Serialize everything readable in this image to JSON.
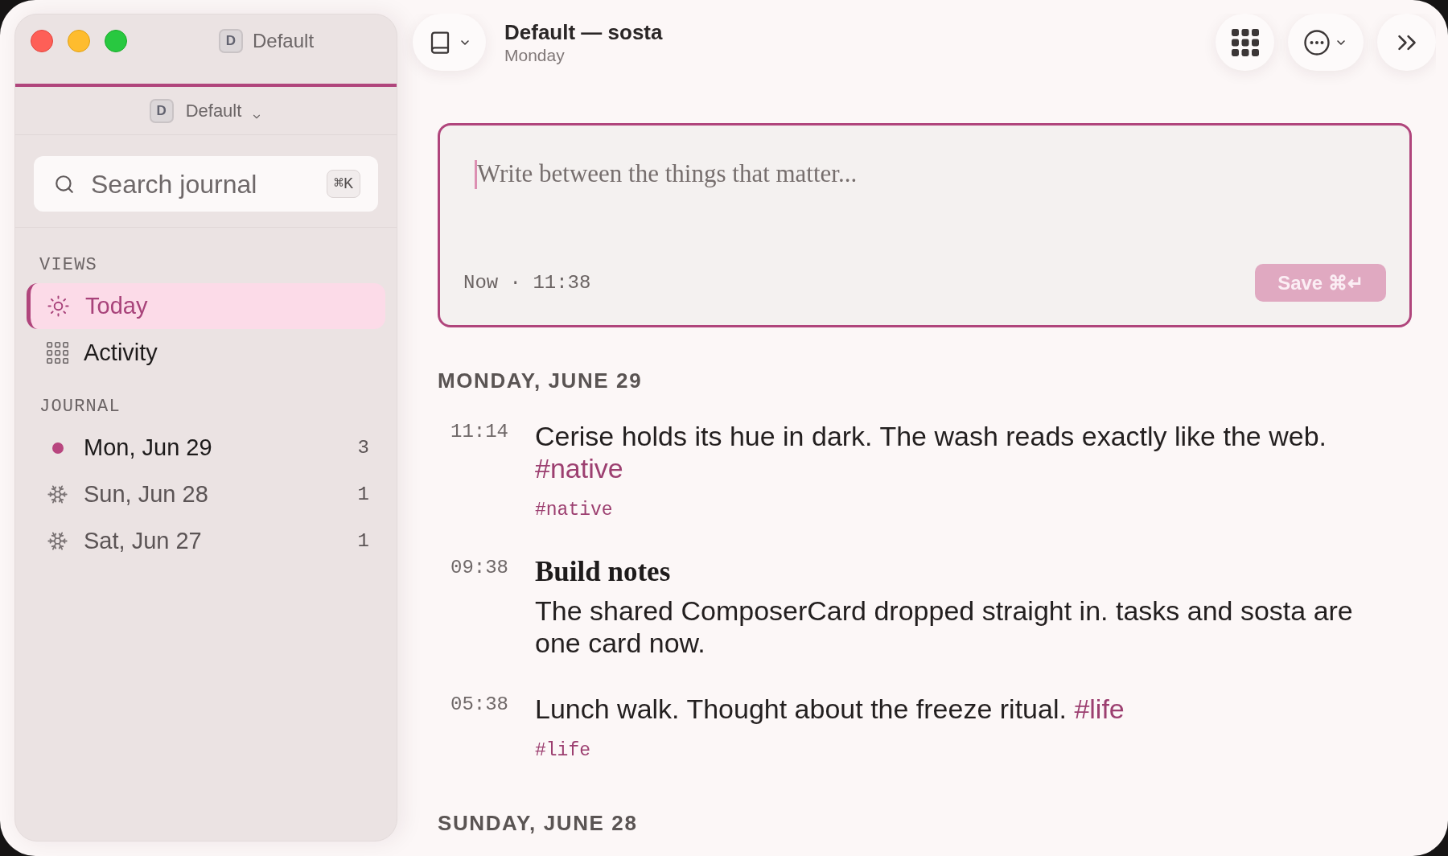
{
  "sidebar": {
    "title_bar": {
      "badge": "D",
      "title": "Default"
    },
    "workspace_switcher": {
      "badge": "D",
      "label": "Default"
    },
    "search": {
      "placeholder": "Search journal",
      "shortcut": "⌘K"
    },
    "sections": [
      {
        "heading": "VIEWS",
        "items": [
          {
            "kind": "today",
            "label": "Today",
            "selected": true
          },
          {
            "kind": "activity",
            "label": "Activity",
            "selected": false
          }
        ]
      },
      {
        "heading": "JOURNAL",
        "items": [
          {
            "kind": "current",
            "label": "Mon, Jun 29",
            "count": "3",
            "selected": false
          },
          {
            "kind": "frozen",
            "label": "Sun, Jun 28",
            "count": "1",
            "selected": false
          },
          {
            "kind": "frozen",
            "label": "Sat, Jun 27",
            "count": "1",
            "selected": false
          }
        ]
      }
    ]
  },
  "header": {
    "title": "Default — sosta",
    "subtitle": "Monday"
  },
  "composer": {
    "placeholder": "Write between the things that matter...",
    "focused": true,
    "meta": "Now · 11:38",
    "save_button": {
      "label": "Save ⌘↵",
      "disabled": true
    }
  },
  "days": [
    {
      "heading": "MONDAY, JUNE 29",
      "entries": [
        {
          "time": "11:14",
          "text": "Cerise holds its hue in dark. The wash reads exactly like the web.",
          "hashtag": "#native",
          "tags": [
            "#native"
          ]
        },
        {
          "time": "09:38",
          "title": "Build notes",
          "text": "The shared ComposerCard dropped straight in. tasks and sosta are one card now."
        },
        {
          "time": "05:38",
          "text": "Lunch walk. Thought about the freeze ritual.",
          "hashtag": "#life",
          "tags": [
            "#life"
          ]
        }
      ]
    },
    {
      "heading": "SUNDAY, JUNE 28"
    }
  ]
}
